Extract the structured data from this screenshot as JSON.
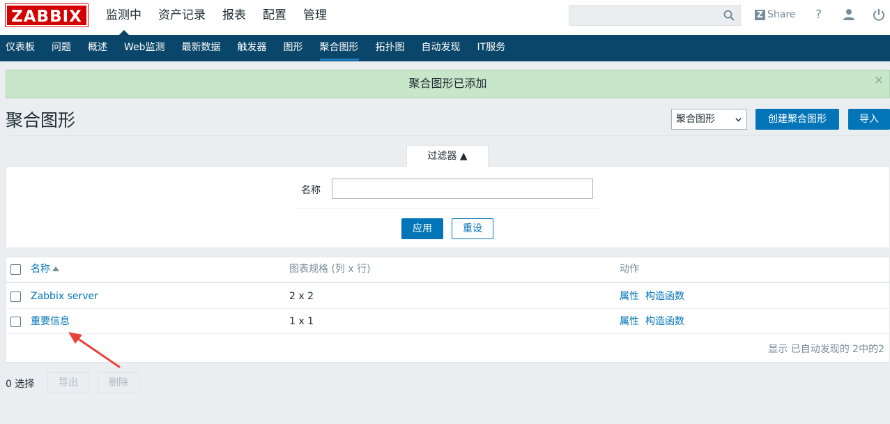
{
  "header": {
    "logo": "ZABBIX",
    "menu": [
      "监测中",
      "资产记录",
      "报表",
      "配置",
      "管理"
    ],
    "active_menu": "监测中",
    "share": "Share",
    "help": "?",
    "search_value": ""
  },
  "nav": {
    "items": [
      "仪表板",
      "问题",
      "概述",
      "Web监测",
      "最新数据",
      "触发器",
      "图形",
      "聚合图形",
      "拓扑图",
      "自动发现",
      "IT服务"
    ],
    "active": "聚合图形"
  },
  "message": {
    "text": "聚合图形已添加",
    "close": "×"
  },
  "page": {
    "title": "聚合图形",
    "select_value": "聚合图形",
    "create_button": "创建聚合图形",
    "import_button": "导入"
  },
  "filter": {
    "tab": "过滤器 ▲",
    "name_label": "名称",
    "name_value": "",
    "apply": "应用",
    "reset": "重设"
  },
  "table": {
    "headers": [
      "名称",
      "图表规格 (列 x 行)",
      "动作"
    ],
    "rows": [
      {
        "name": "Zabbix server",
        "dims": "2 x 2",
        "action1": "属性",
        "action2": "构造函数"
      },
      {
        "name": "重要信息",
        "dims": "1 x 1",
        "action1": "属性",
        "action2": "构造函数"
      }
    ],
    "footer": "显示 已自动发现的 2中的2"
  },
  "bottom": {
    "selected": "0 选择",
    "export": "导出",
    "delete": "删除"
  },
  "colors": {
    "nav_bg": "#0a466a",
    "logo_red": "#d40000",
    "link_blue": "#0275b8",
    "success_bg": "#c8e6c9",
    "annotation_red": "#e8423b"
  }
}
